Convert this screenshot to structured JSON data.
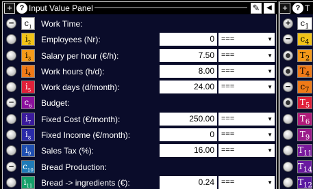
{
  "panel": {
    "title": "Input Value Panel",
    "plus_glyph": "+",
    "help_glyph": "?",
    "pencil_glyph": "✎",
    "arrow_glyph": "◀"
  },
  "rows": [
    {
      "kind": "group",
      "sym": "c",
      "sub": "1",
      "sym_color": "#ffffff",
      "label": "Work Time:"
    },
    {
      "kind": "input",
      "sym": "i",
      "sub": "2",
      "sym_color": "#f2c318",
      "label": "Employees (Nr):",
      "value": "0",
      "op": "==="
    },
    {
      "kind": "input",
      "sym": "i",
      "sub": "3",
      "sym_color": "#f59a1a",
      "label": "Salary per hour (€/h):",
      "value": "7.50",
      "op": "==="
    },
    {
      "kind": "input",
      "sym": "i",
      "sub": "4",
      "sym_color": "#f07a18",
      "label": "Work hours (h/d):",
      "value": "8.00",
      "op": "==="
    },
    {
      "kind": "input",
      "sym": "i",
      "sub": "5",
      "sym_color": "#e0203a",
      "label": "Work days (d/month):",
      "value": "24.00",
      "op": "==="
    },
    {
      "kind": "group",
      "sym": "c",
      "sub": "6",
      "sym_color": "#8a0f9c",
      "label": "Budget:"
    },
    {
      "kind": "input",
      "sym": "i",
      "sub": "7",
      "sym_color": "#3a1a9c",
      "label": "Fixed Cost (€/month):",
      "value": "250.00",
      "op": "==="
    },
    {
      "kind": "input",
      "sym": "i",
      "sub": "8",
      "sym_color": "#2a2aa8",
      "label": "Fixed Income (€/month):",
      "value": "0",
      "op": "==="
    },
    {
      "kind": "input",
      "sym": "i",
      "sub": "9",
      "sym_color": "#1f4fb0",
      "label": "Sales Tax (%):",
      "value": "16.00",
      "op": "==="
    },
    {
      "kind": "group",
      "sym": "c",
      "sub": "10",
      "sym_color": "#1f7bb8",
      "label": "Bread Production:"
    },
    {
      "kind": "input",
      "sym": "i",
      "sub": "11",
      "sym_color": "#16a06a",
      "label": "Bread -> ingredients (€):",
      "value": "0.24",
      "op": "==="
    }
  ],
  "side_panel": {
    "title_first_letter": "T",
    "rows": [
      {
        "ctrl": "plus",
        "sym": "c",
        "sub": "1",
        "sym_color": "#ffffff"
      },
      {
        "ctrl": "minus",
        "sym": "c",
        "sub": "4",
        "sym_color": "#f2c318"
      },
      {
        "ctrl": "radio-selected",
        "sym": "T",
        "sub": "2",
        "sym_color": "#f59a1a"
      },
      {
        "ctrl": "radio-selected",
        "sym": "T",
        "sub": "4",
        "sym_color": "#f07a18"
      },
      {
        "ctrl": "minus",
        "sym": "c",
        "sub": "7",
        "sym_color": "#f07a18"
      },
      {
        "ctrl": "radio-selected",
        "sym": "T",
        "sub": "5",
        "sym_color": "#e0203a"
      },
      {
        "ctrl": "radio",
        "sym": "T",
        "sub": "6",
        "sym_color": "#b01a7a"
      },
      {
        "ctrl": "radio",
        "sym": "T",
        "sub": "9",
        "sym_color": "#9a1a8a"
      },
      {
        "ctrl": "radio",
        "sym": "T",
        "sub": "11",
        "sym_color": "#7a1a9c"
      },
      {
        "ctrl": "radio",
        "sym": "T",
        "sub": "14",
        "sym_color": "#6a1aa0"
      },
      {
        "ctrl": "radio",
        "sym": "T",
        "sub": "12",
        "sym_color": "#5a1aa0"
      }
    ]
  }
}
